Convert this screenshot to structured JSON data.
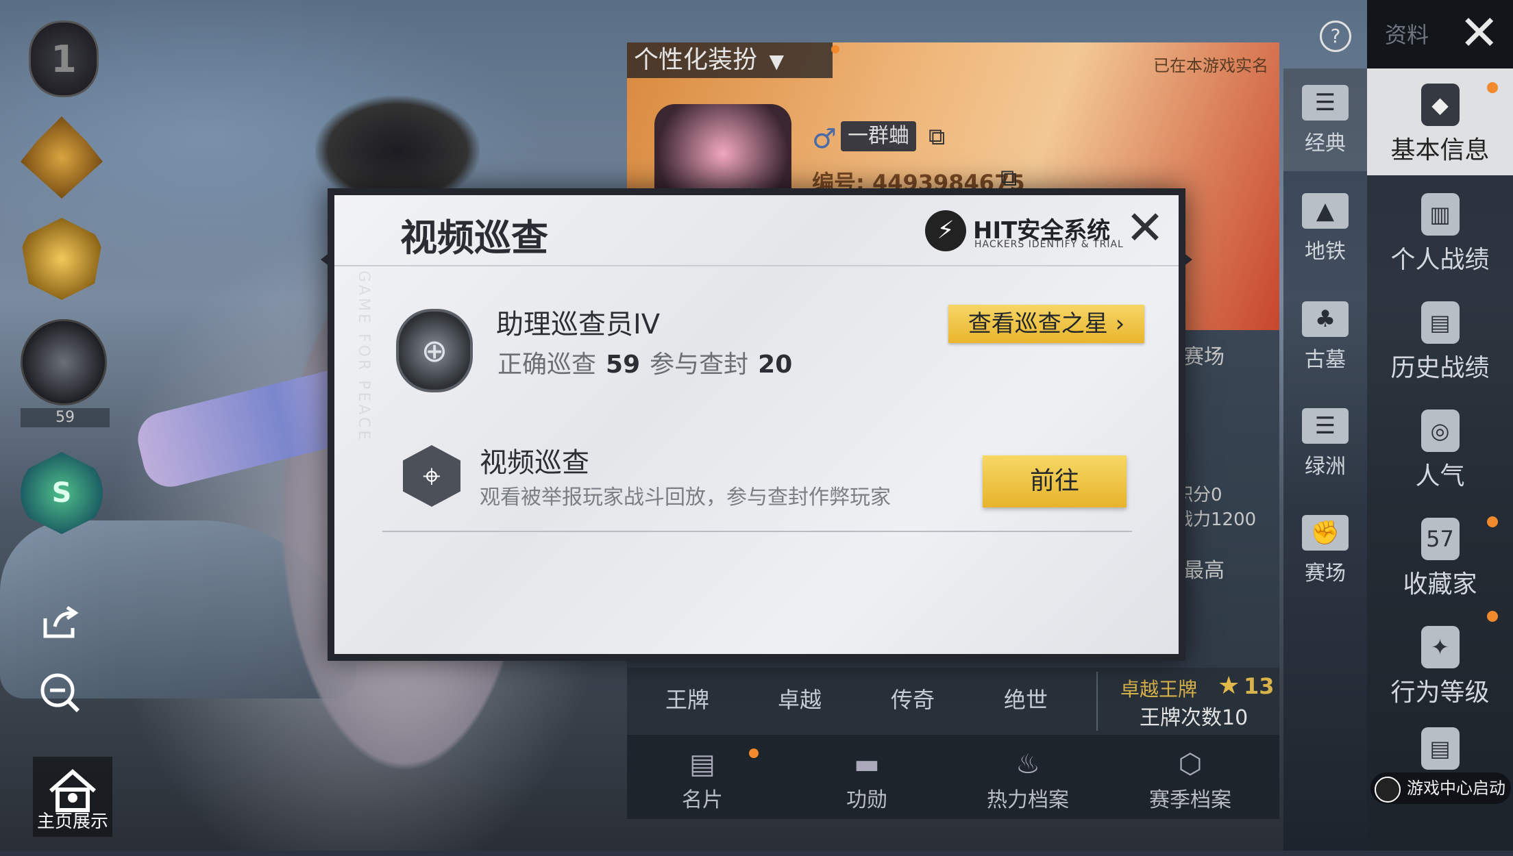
{
  "left_column": {
    "level_badge": "1",
    "scope_badge_count": "59",
    "s_badge": "S",
    "home_label": "主页展示"
  },
  "profile": {
    "dress_tab": "个性化装扮",
    "realname_status": "已在本游戏实名",
    "nickname": "一群蛐",
    "uid": "编号: 4493984675",
    "side_texts": [
      "赛场",
      "积分0",
      "战力1200",
      "最高"
    ],
    "tiers": [
      "王牌",
      "卓越",
      "传奇",
      "绝世"
    ],
    "ace_label": "卓越王牌",
    "ace_stars": "13",
    "ace_count": "王牌次数10"
  },
  "bottom_tabs": [
    {
      "label": "名片",
      "icon": "card-icon"
    },
    {
      "label": "功勋",
      "icon": "medal-icon"
    },
    {
      "label": "热力档案",
      "icon": "flame-icon"
    },
    {
      "label": "赛季档案",
      "icon": "season-icon"
    }
  ],
  "mode_tabs": [
    {
      "label": "经典",
      "icon": "person-card-icon",
      "active": true
    },
    {
      "label": "地铁",
      "icon": "mountain-icon"
    },
    {
      "label": "古墓",
      "icon": "tomb-icon"
    },
    {
      "label": "绿洲",
      "icon": "oasis-icon"
    },
    {
      "label": "赛场",
      "icon": "arena-icon"
    }
  ],
  "right_sidebar": {
    "title": "资料",
    "items": [
      {
        "label": "基本信息",
        "icon": "user-shield-icon",
        "active": true,
        "dot": true
      },
      {
        "label": "个人战绩",
        "icon": "chart-doc-icon"
      },
      {
        "label": "历史战绩",
        "icon": "history-doc-icon"
      },
      {
        "label": "人气",
        "icon": "popularity-icon"
      },
      {
        "label": "收藏家",
        "icon": "collector-icon",
        "badge": "57",
        "dot": true
      },
      {
        "label": "行为等级",
        "icon": "behavior-icon",
        "dot": true
      },
      {
        "label": "",
        "icon": "document-icon"
      }
    ],
    "launch_tag": "游戏中心启动"
  },
  "dialog": {
    "title": "视频巡查",
    "brand_name": "HIT安全系统",
    "brand_sub": "HACKERS IDENTIFY & TRIAL",
    "watermark": "GAME FOR PEACE",
    "rank_name": "助理巡查员IV",
    "correct_label": "正确巡查",
    "correct_value": "59",
    "ban_label": "参与查封",
    "ban_value": "20",
    "star_button": "查看巡查之星 ›",
    "task_title": "视频巡查",
    "task_desc": "观看被举报玩家战斗回放，参与查封作弊玩家",
    "go_button": "前往"
  }
}
